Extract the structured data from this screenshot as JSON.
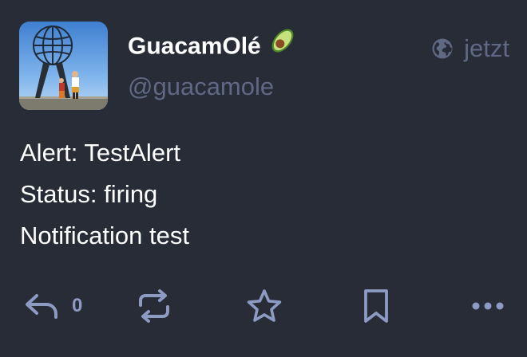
{
  "status": {
    "author": {
      "display_name": "GuacamOlé",
      "emoji": "avocado-emoji",
      "handle": "@guacamole"
    },
    "visibility_icon": "globe-icon",
    "timestamp": "jetzt",
    "content": [
      "Alert: TestAlert",
      "Status: firing",
      "Notification test"
    ],
    "actions": {
      "reply_icon": "reply-icon",
      "reply_count": "0",
      "boost_icon": "boost-icon",
      "favourite_icon": "star-icon",
      "bookmark_icon": "bookmark-icon",
      "more_icon": "ellipsis-icon"
    },
    "colors": {
      "background": "#282c37",
      "text": "#ffffff",
      "muted": "#606984",
      "action": "#8d9ac2"
    }
  }
}
